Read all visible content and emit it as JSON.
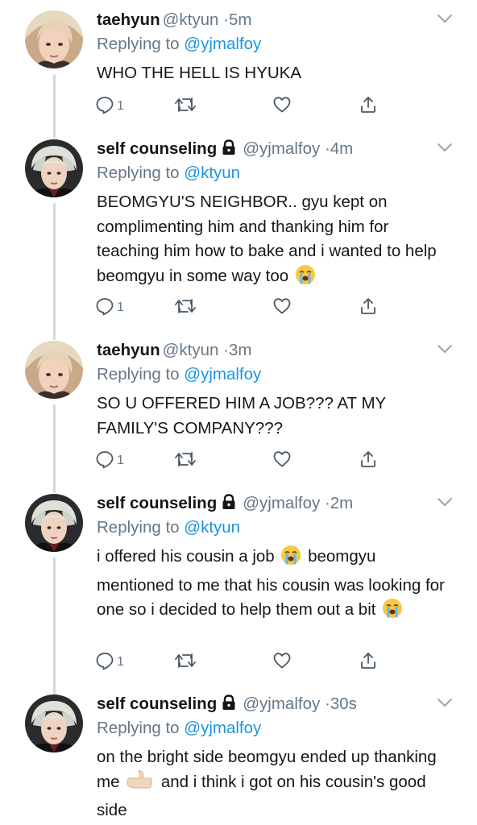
{
  "tweets": [
    {
      "name": "taehyun",
      "handle": "@ktyun",
      "sep": "·",
      "time": "5m",
      "locked": false,
      "replying_prefix": "Replying to ",
      "replying_to": "@yjmalfoy",
      "text_parts": [
        "WHO THE HELL IS HYUKA"
      ],
      "reply_count": "1",
      "avatar": "blonde"
    },
    {
      "name": "self counseling",
      "handle": "@yjmalfoy",
      "sep": "·",
      "time": "4m",
      "locked": true,
      "replying_prefix": "Replying to ",
      "replying_to": "@ktyun",
      "text_parts": [
        "BEOMGYU'S NEIGHBOR.. gyu kept on complimenting him and thanking him for teaching him how to bake and i wanted to help beomgyu in some way too "
      ],
      "reply_count": "1",
      "avatar": "silver"
    },
    {
      "name": "taehyun",
      "handle": "@ktyun",
      "sep": "·",
      "time": "3m",
      "locked": false,
      "replying_prefix": "Replying to ",
      "replying_to": "@yjmalfoy",
      "text_parts": [
        "SO U OFFERED HIM A JOB??? AT MY FAMILY'S COMPANY???"
      ],
      "reply_count": "1",
      "avatar": "blonde"
    },
    {
      "name": "self counseling",
      "handle": "@yjmalfoy",
      "sep": "·",
      "time": "2m",
      "locked": true,
      "replying_prefix": "Replying to ",
      "replying_to": "@ktyun",
      "text_parts": [
        "i offered his cousin a job ",
        " beomgyu mentioned to me that his cousin was looking for one so i decided to help them out a bit "
      ],
      "reply_count": "1",
      "avatar": "silver"
    },
    {
      "name": "self counseling",
      "handle": "@yjmalfoy",
      "sep": "·",
      "time": "30s",
      "locked": true,
      "replying_prefix": "Replying to ",
      "replying_to": "@yjmalfoy",
      "text_parts": [
        "on the bright side beomgyu ended up thanking me ",
        " and i think i got on his cousin's good side"
      ],
      "reply_count": "",
      "avatar": "silver"
    }
  ],
  "icons": {
    "reply": "reply-icon",
    "retweet": "retweet-icon",
    "like": "heart-icon",
    "share": "share-icon",
    "menu": "chevron-down-icon",
    "lock": "lock-icon",
    "crying": "loudly-crying-face-emoji",
    "thumbs": "thumbs-up-emoji"
  },
  "colors": {
    "link": "#1b95e0",
    "secondary": "#657786",
    "thread_line": "#cfd9de"
  }
}
